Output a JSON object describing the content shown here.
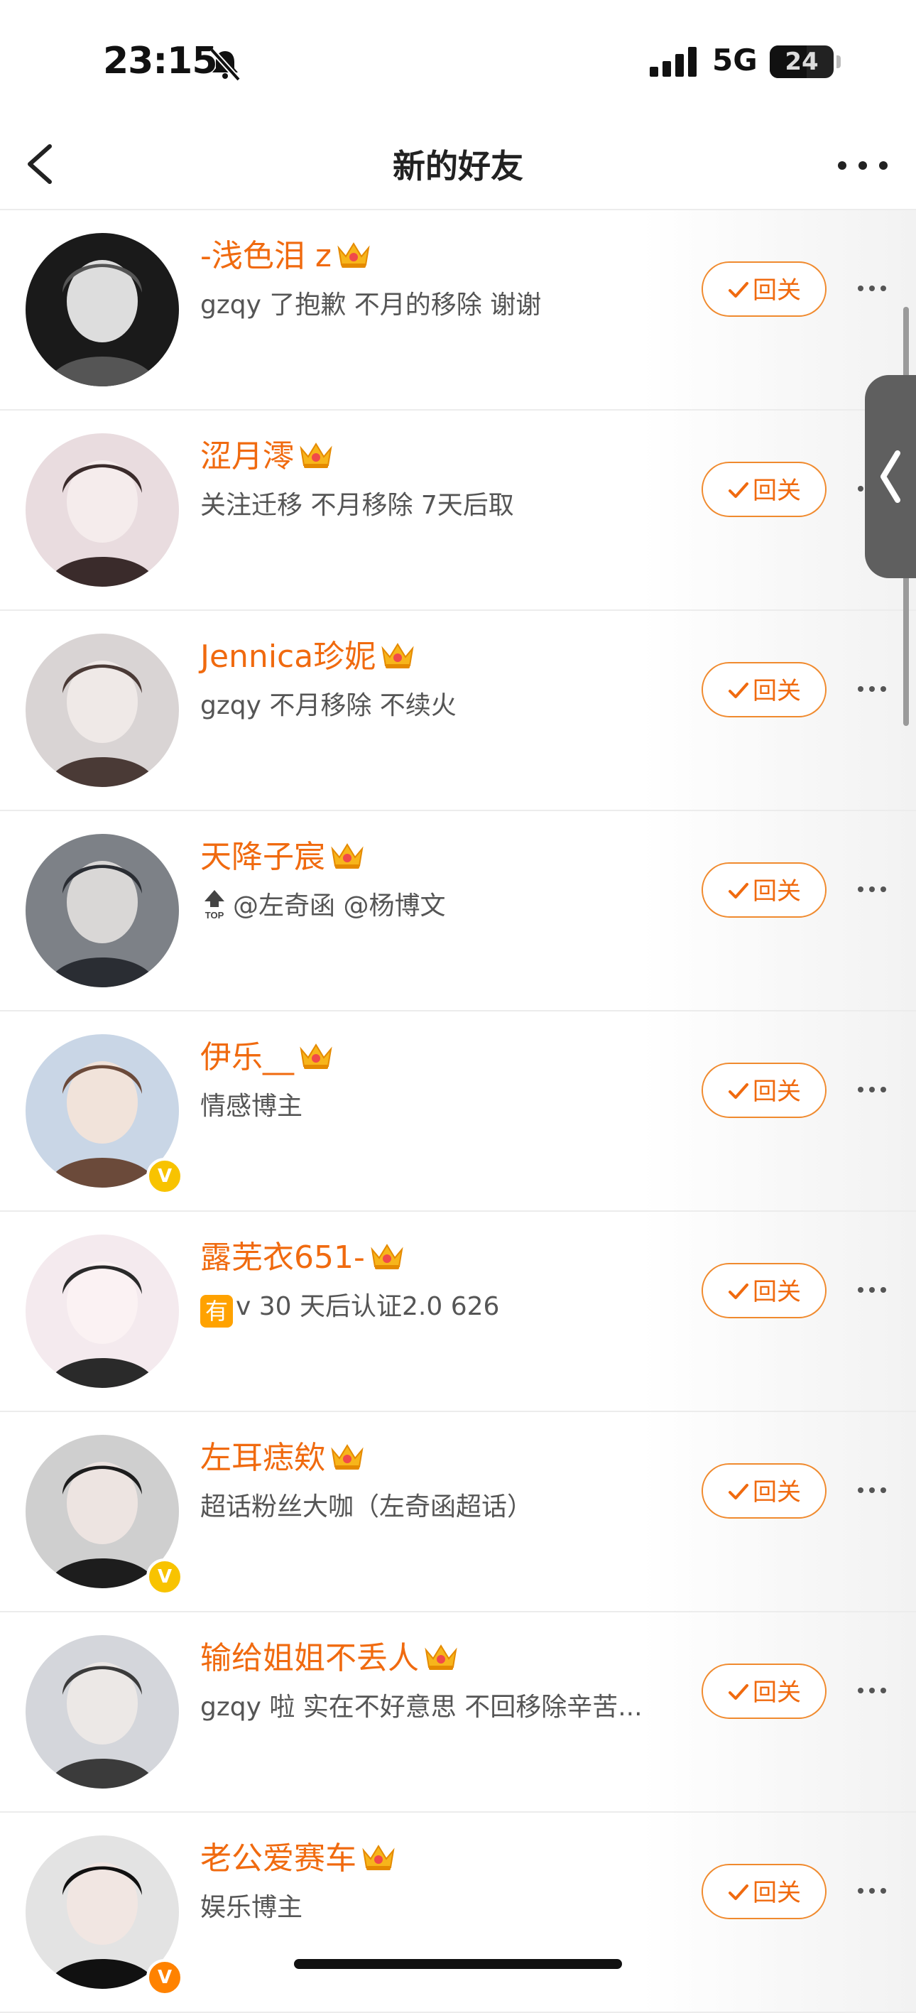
{
  "status_bar": {
    "time": "23:15",
    "network": "5G",
    "battery": "24"
  },
  "nav": {
    "title": "新的好友"
  },
  "follow_label": "回关",
  "colors": {
    "accent": "#f06a0f",
    "badge_yellow": "#f8c300",
    "badge_orange": "#ff8200"
  },
  "friends": [
    {
      "name": "-浅色泪 z",
      "desc": "gzqy 了抱歉 不月的移除 谢谢",
      "badge": ""
    },
    {
      "name": "涩月澪",
      "desc": "关注迁移 不月移除 7天后取",
      "badge": ""
    },
    {
      "name": "Jennica珍妮",
      "desc": "gzqy 不月移除 不续火",
      "badge": ""
    },
    {
      "name": "天降子宸",
      "desc": "@左奇函 @杨博文",
      "desc_icon": "top-icon",
      "badge": ""
    },
    {
      "name": "伊乐__",
      "desc": "情感博主",
      "badge": "V"
    },
    {
      "name": "露芜衣651-",
      "desc": "v 30 天后认证2.0 626",
      "desc_icon": "有",
      "badge": ""
    },
    {
      "name": "左耳痣欸",
      "desc": "超话粉丝大咖（左奇函超话）",
      "badge": "V"
    },
    {
      "name": "输给姐姐不丢人",
      "desc": "gzqy 啦 实在不好意思 不回移除辛苦...",
      "badge": ""
    },
    {
      "name": "老公爱赛车",
      "desc": "娱乐博主",
      "badge": "V"
    }
  ]
}
